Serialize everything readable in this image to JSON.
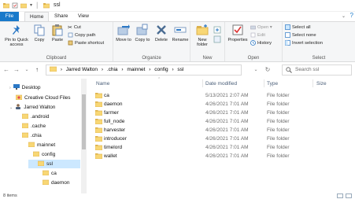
{
  "window": {
    "title": "ssl"
  },
  "tabs": [
    {
      "label": "File"
    },
    {
      "label": "Home"
    },
    {
      "label": "Share"
    },
    {
      "label": "View"
    }
  ],
  "ribbon": {
    "clipboard": {
      "label": "Clipboard",
      "pin_to_quick_access": "Pin to Quick access",
      "copy": "Copy",
      "paste": "Paste",
      "cut": "Cut",
      "copy_path": "Copy path",
      "paste_shortcut": "Paste shortcut"
    },
    "organize": {
      "label": "Organize",
      "move_to": "Move to",
      "copy_to": "Copy to",
      "delete": "Delete",
      "rename": "Rename"
    },
    "new": {
      "label": "New",
      "new_folder": "New folder"
    },
    "open": {
      "label": "Open",
      "properties": "Properties",
      "open": "Open",
      "edit": "Edit",
      "history": "History"
    },
    "select": {
      "label": "Select",
      "select_all": "Select all",
      "select_none": "Select none",
      "invert_selection": "Invert selection"
    }
  },
  "address": {
    "crumbs": [
      "Jarred Walton",
      ".chia",
      "mainnet",
      "config",
      "ssl"
    ],
    "separator": "›",
    "search_placeholder": "Search ssl"
  },
  "navpane": {
    "items": [
      {
        "label": "Desktop"
      },
      {
        "label": "Creative Cloud Files"
      },
      {
        "label": "Jarred Walton"
      },
      {
        "label": ".android"
      },
      {
        "label": ".cache"
      },
      {
        "label": ".chia"
      },
      {
        "label": "mainnet"
      },
      {
        "label": "config"
      },
      {
        "label": "ssl"
      },
      {
        "label": "ca"
      },
      {
        "label": "daemon"
      }
    ]
  },
  "columns": {
    "name": "Name",
    "date_modified": "Date modified",
    "type": "Type",
    "size": "Size"
  },
  "files": [
    {
      "name": "ca",
      "date": "5/13/2021 2:07 AM",
      "type": "File folder"
    },
    {
      "name": "daemon",
      "date": "4/26/2021 7:01 AM",
      "type": "File folder"
    },
    {
      "name": "farmer",
      "date": "4/26/2021 7:01 AM",
      "type": "File folder"
    },
    {
      "name": "full_node",
      "date": "4/26/2021 7:01 AM",
      "type": "File folder"
    },
    {
      "name": "harvester",
      "date": "4/26/2021 7:01 AM",
      "type": "File folder"
    },
    {
      "name": "introducer",
      "date": "4/26/2021 7:01 AM",
      "type": "File folder"
    },
    {
      "name": "timelord",
      "date": "4/26/2021 7:01 AM",
      "type": "File folder"
    },
    {
      "name": "wallet",
      "date": "4/26/2021 7:01 AM",
      "type": "File folder"
    }
  ],
  "status": {
    "item_count": "8 items"
  },
  "colors": {
    "accent": "#1979ca",
    "folder": "#f8d775",
    "folder_dark": "#dcb04a",
    "selection": "#cce8ff"
  }
}
